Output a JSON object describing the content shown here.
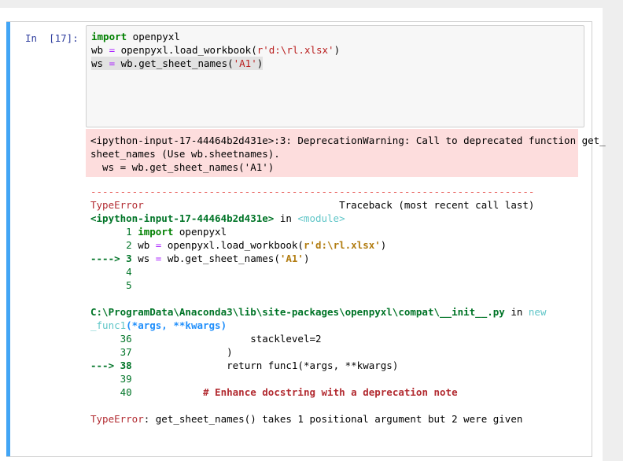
{
  "cell": {
    "prompt": "In  [17]:",
    "code": [
      {
        "kw": "import",
        "rest": " openpyxl"
      },
      {
        "pre": "wb ",
        "op": "=",
        "mid": " openpyxl.load_workbook(",
        "str": "r'd:\\rl.xlsx'",
        "post": ")"
      },
      {
        "pre": "ws ",
        "op": "=",
        "mid": " wb.get_sheet_names(",
        "str": "'A1'",
        "post": ")"
      }
    ]
  },
  "stderr": {
    "lines": [
      "<ipython-input-17-44464b2d431e>:3: DeprecationWarning: Call to deprecated function get_",
      "sheet_names (Use wb.sheetnames).",
      "  ws = wb.get_sheet_names('A1')"
    ]
  },
  "traceback": {
    "separator": "---------------------------------------------------------------------------",
    "error_name": "TypeError",
    "header_right": "                                 Traceback (most recent call last)",
    "input_ref": "<ipython-input-17-44464b2d431e>",
    "in_word": " in ",
    "module": "<module>",
    "frame1": [
      {
        "arrow": "      ",
        "num": "1",
        "code_kw": "import",
        "code": " openpyxl"
      },
      {
        "arrow": "      ",
        "num": "2",
        "code_pre": " wb ",
        "code_op": "=",
        "code_mid": " openpyxl.load_workbook(",
        "code_str": "r'd:\\rl.xlsx'",
        "code_post": ")"
      },
      {
        "arrow": "----> ",
        "num": "3",
        "code_pre": " ws ",
        "code_op": "=",
        "code_mid": " wb.get_sheet_names(",
        "code_str": "'A1'",
        "code_post": ")"
      },
      {
        "arrow": "      ",
        "num": "4"
      },
      {
        "arrow": "      ",
        "num": "5"
      }
    ],
    "path": "C:\\ProgramData\\Anaconda3\\lib\\site-packages\\openpyxl\\compat\\__init__.py",
    "path_in": " in ",
    "func_a": "new",
    "func_b": "_func1",
    "func_args": "(*args, **kwargs)",
    "frame2": [
      {
        "arrow": "     ",
        "num": "36",
        "code": "                    stacklevel=2"
      },
      {
        "arrow": "     ",
        "num": "37",
        "code": "                )"
      },
      {
        "arrow": "---> ",
        "num": "38",
        "code": "                return func1(*args, **kwargs)"
      },
      {
        "arrow": "     ",
        "num": "39",
        "code": ""
      },
      {
        "arrow": "     ",
        "num": "40",
        "code": "            # Enhance docstring with a deprecation note"
      }
    ],
    "final_name": "TypeError",
    "final_msg": ": get_sheet_names() takes 1 positional argument but 2 were given"
  }
}
